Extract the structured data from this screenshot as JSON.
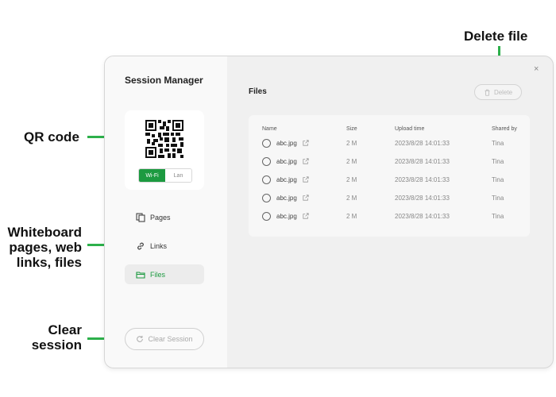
{
  "callouts": {
    "delete_file": "Delete file",
    "qr_code": "QR code",
    "whiteboard_line1": "Whiteboard",
    "whiteboard_line2": "pages, web",
    "whiteboard_line3": "links, files",
    "clear_line1": "Clear",
    "clear_line2": "session",
    "accent_color": "#2db04b"
  },
  "window": {
    "title": "Session Manager",
    "close_glyph": "×"
  },
  "qr": {
    "toggle_options": [
      "Wi-Fi",
      "Lan"
    ],
    "selected": "Wi-Fi"
  },
  "nav": {
    "items": [
      {
        "label": "Pages",
        "icon": "pages-icon"
      },
      {
        "label": "Links",
        "icon": "link-icon"
      },
      {
        "label": "Files",
        "icon": "folder-icon",
        "active": true
      }
    ]
  },
  "clear_session": {
    "label": "Clear Session",
    "icon": "refresh-icon"
  },
  "main": {
    "title": "Files",
    "delete_label": "Delete"
  },
  "table": {
    "headers": [
      "Name",
      "Size",
      "Upload time",
      "Shared by"
    ],
    "rows": [
      {
        "name": "abc.jpg",
        "size": "2 M",
        "time": "2023/8/28 14:01:33",
        "shared_by": "Tina"
      },
      {
        "name": "abc.jpg",
        "size": "2 M",
        "time": "2023/8/28 14:01:33",
        "shared_by": "Tina"
      },
      {
        "name": "abc.jpg",
        "size": "2 M",
        "time": "2023/8/28 14:01:33",
        "shared_by": "Tina"
      },
      {
        "name": "abc.jpg",
        "size": "2 M",
        "time": "2023/8/28 14:01:33",
        "shared_by": "Tina"
      },
      {
        "name": "abc.jpg",
        "size": "2 M",
        "time": "2023/8/28 14:01:33",
        "shared_by": "Tina"
      }
    ]
  },
  "colors": {
    "brand_green": "#1c9a40"
  }
}
